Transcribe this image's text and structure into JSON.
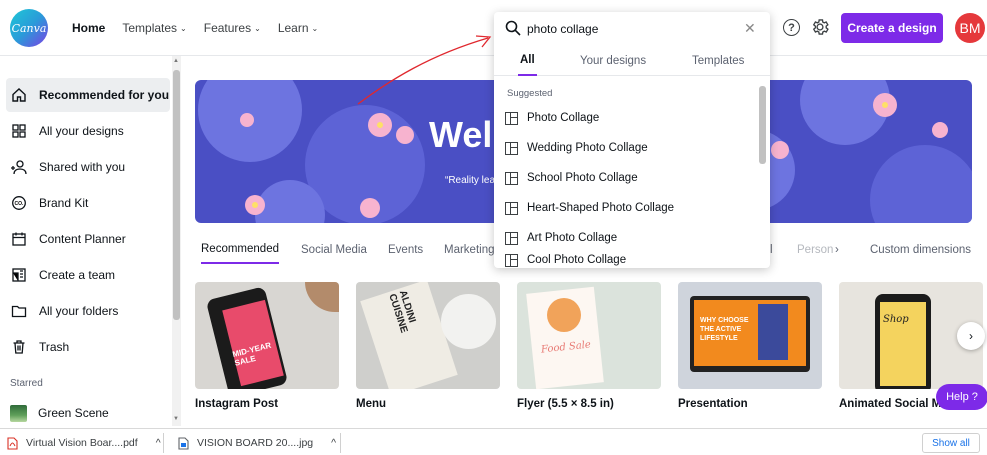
{
  "app": {
    "logo_text": "Canva"
  },
  "nav": {
    "home": "Home",
    "templates": "Templates",
    "features": "Features",
    "learn": "Learn",
    "chevron": "⌄"
  },
  "header": {
    "help_glyph": "?",
    "create_label": "Create a design",
    "avatar_initials": "BM"
  },
  "search": {
    "value": "photo collage",
    "clear_glyph": "✕",
    "tabs": [
      "All",
      "Your designs",
      "Templates"
    ],
    "suggested_heading": "Suggested",
    "suggestions": [
      "Photo Collage",
      "Wedding Photo Collage",
      "School Photo Collage",
      "Heart-Shaped Photo Collage",
      "Art Photo Collage",
      "Cool Photo Collage"
    ]
  },
  "sidebar": {
    "items": [
      {
        "label": "Recommended for you",
        "icon": "home-icon"
      },
      {
        "label": "All your designs",
        "icon": "grid-icon"
      },
      {
        "label": "Shared with you",
        "icon": "shared-people-icon"
      },
      {
        "label": "Brand Kit",
        "icon": "brand-kit-icon"
      },
      {
        "label": "Content Planner",
        "icon": "calendar-icon"
      },
      {
        "label": "Create a team",
        "icon": "team-icon"
      },
      {
        "label": "All your folders",
        "icon": "folder-icon"
      },
      {
        "label": "Trash",
        "icon": "trash-icon"
      }
    ],
    "starred_heading": "Starred",
    "starred_items": [
      {
        "label": "Green Scene"
      }
    ]
  },
  "hero": {
    "title": "Wel",
    "subtitle": "“Reality lea"
  },
  "category_tabs": [
    "Recommended",
    "Social Media",
    "Events",
    "Marketing",
    "l",
    "Person",
    "Custom dimensions"
  ],
  "category_more_glyph": "›",
  "cards": [
    {
      "label": "Instagram Post",
      "thumb_text": "MID-YEAR SALE"
    },
    {
      "label": "Menu",
      "thumb_text": "ALDINI CUISINE"
    },
    {
      "label": "Flyer (5.5 × 8.5 in)",
      "thumb_text": "Food Sale"
    },
    {
      "label": "Presentation",
      "thumb_text": "WHY CHOOSE THE ACTIVE LIFESTYLE"
    },
    {
      "label": "Animated Social Me",
      "thumb_text": "Shop"
    }
  ],
  "carousel_next_glyph": "›",
  "help_button": "Help ?",
  "downloads": {
    "items": [
      {
        "name": "Virtual Vision Boar....pdf",
        "icon": "pdf-icon"
      },
      {
        "name": "VISION BOARD 20....jpg",
        "icon": "image-file-icon"
      }
    ],
    "caret": "^",
    "show_all": "Show all"
  },
  "colors": {
    "accent": "#7d2ae8",
    "avatar": "#e5383b",
    "hero_bg": "#4a4fc4",
    "annotation_arrow": "#e0282e"
  }
}
